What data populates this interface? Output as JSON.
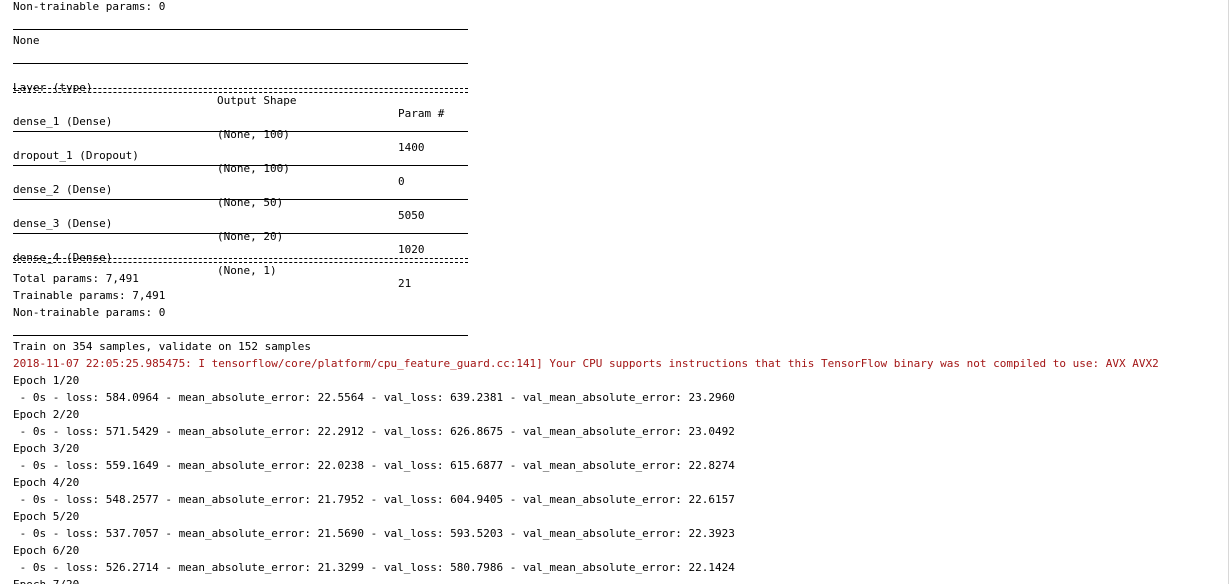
{
  "header": {
    "top_nontrainable": "Non-trainable params: 0",
    "none": "None"
  },
  "summary": {
    "columns": [
      "Layer (type)",
      "Output Shape",
      "Param #"
    ],
    "rows": [
      {
        "layer": "dense_1 (Dense)",
        "shape": "(None, 100)",
        "params": "1400"
      },
      {
        "layer": "dropout_1 (Dropout)",
        "shape": "(None, 100)",
        "params": "0"
      },
      {
        "layer": "dense_2 (Dense)",
        "shape": "(None, 50)",
        "params": "5050"
      },
      {
        "layer": "dense_3 (Dense)",
        "shape": "(None, 20)",
        "params": "1020"
      },
      {
        "layer": "dense_4 (Dense)",
        "shape": "(None, 1)",
        "params": "21"
      }
    ],
    "total": "Total params: 7,491",
    "trainable": "Trainable params: 7,491",
    "nontrainable": "Non-trainable params: 0"
  },
  "training": {
    "header": "Train on 354 samples, validate on 152 samples",
    "warning": "2018-11-07 22:05:25.985475: I tensorflow/core/platform/cpu_feature_guard.cc:141] Your CPU supports instructions that this TensorFlow binary was not compiled to use: AVX AVX2",
    "epochs": [
      {
        "label": "Epoch 1/20",
        "metrics": " - 0s - loss: 584.0964 - mean_absolute_error: 22.5564 - val_loss: 639.2381 - val_mean_absolute_error: 23.2960"
      },
      {
        "label": "Epoch 2/20",
        "metrics": " - 0s - loss: 571.5429 - mean_absolute_error: 22.2912 - val_loss: 626.8675 - val_mean_absolute_error: 23.0492"
      },
      {
        "label": "Epoch 3/20",
        "metrics": " - 0s - loss: 559.1649 - mean_absolute_error: 22.0238 - val_loss: 615.6877 - val_mean_absolute_error: 22.8274"
      },
      {
        "label": "Epoch 4/20",
        "metrics": " - 0s - loss: 548.2577 - mean_absolute_error: 21.7952 - val_loss: 604.9405 - val_mean_absolute_error: 22.6157"
      },
      {
        "label": "Epoch 5/20",
        "metrics": " - 0s - loss: 537.7057 - mean_absolute_error: 21.5690 - val_loss: 593.5203 - val_mean_absolute_error: 22.3923"
      },
      {
        "label": "Epoch 6/20",
        "metrics": " - 0s - loss: 526.2714 - mean_absolute_error: 21.3299 - val_loss: 580.7986 - val_mean_absolute_error: 22.1424"
      }
    ],
    "partial_label": "Epoch 7/20"
  }
}
